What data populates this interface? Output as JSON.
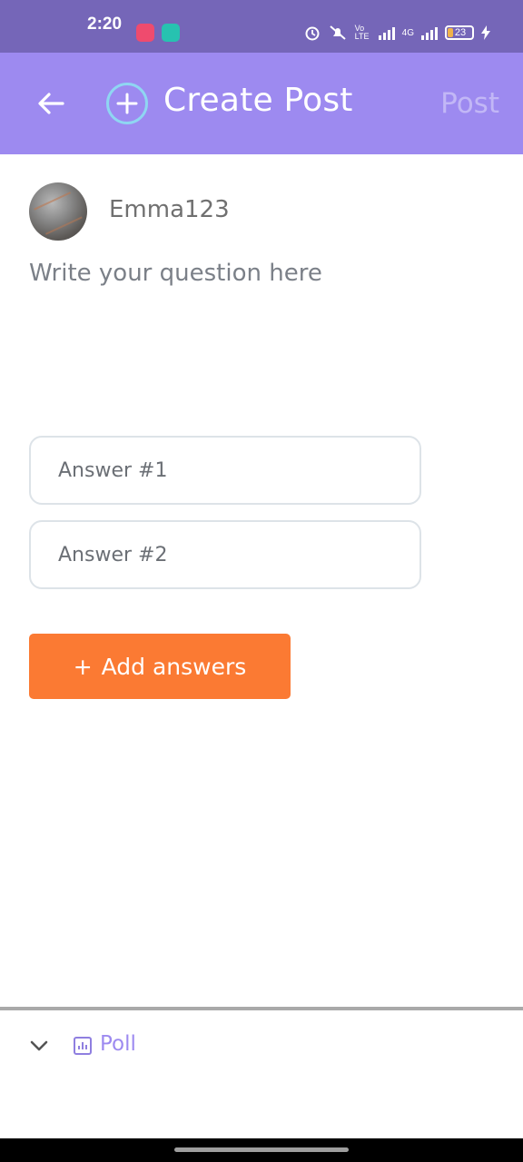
{
  "status_bar": {
    "time": "2:20",
    "net_volte": "Vo LTE",
    "net_4g": "4G",
    "battery": "23"
  },
  "app_bar": {
    "title": "Create Post",
    "post_label": "Post",
    "icons": {
      "back": "arrow-left-icon",
      "create": "plus-circle-icon"
    },
    "colors": {
      "background": "#9d8af0",
      "post_disabled": "#c2b7f6"
    }
  },
  "author": {
    "username": "Emma123"
  },
  "question": {
    "placeholder": "Write your question here"
  },
  "answers": [
    {
      "placeholder": "Answer #1"
    },
    {
      "placeholder": "Answer #2"
    }
  ],
  "add_answers": {
    "plus": "+",
    "label": "Add answers",
    "color": "#fb7a33"
  },
  "bottom": {
    "post_type_label": "Poll",
    "icons": {
      "collapse": "chevron-down-icon",
      "poll": "poll-chart-icon"
    }
  }
}
